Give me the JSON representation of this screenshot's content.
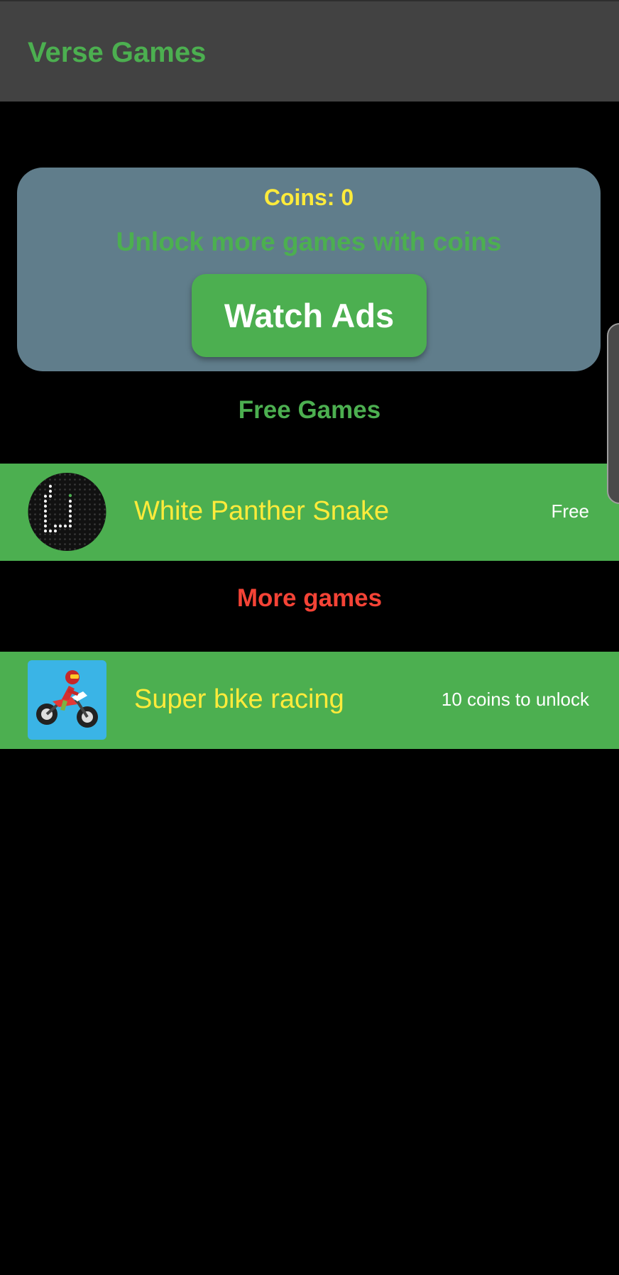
{
  "appbar": {
    "title": "Verse Games"
  },
  "coins_card": {
    "coins_label": "Coins: 0",
    "unlock_text": "Unlock more games with coins",
    "watch_ads_label": "Watch Ads"
  },
  "sections": {
    "free_title": "Free Games",
    "more_title": "More games"
  },
  "games": [
    {
      "name": "White Panther Snake",
      "status": "Free",
      "icon": "snake-game-icon"
    },
    {
      "name": "Super bike racing",
      "status": "10 coins to unlock",
      "icon": "bike-racing-icon"
    }
  ],
  "colors": {
    "appbar": "#424242",
    "accent_green": "#4caf50",
    "coins_yellow": "#ffeb3b",
    "card_bluegrey": "#607d8b",
    "more_red": "#f44336",
    "background": "#000000"
  }
}
